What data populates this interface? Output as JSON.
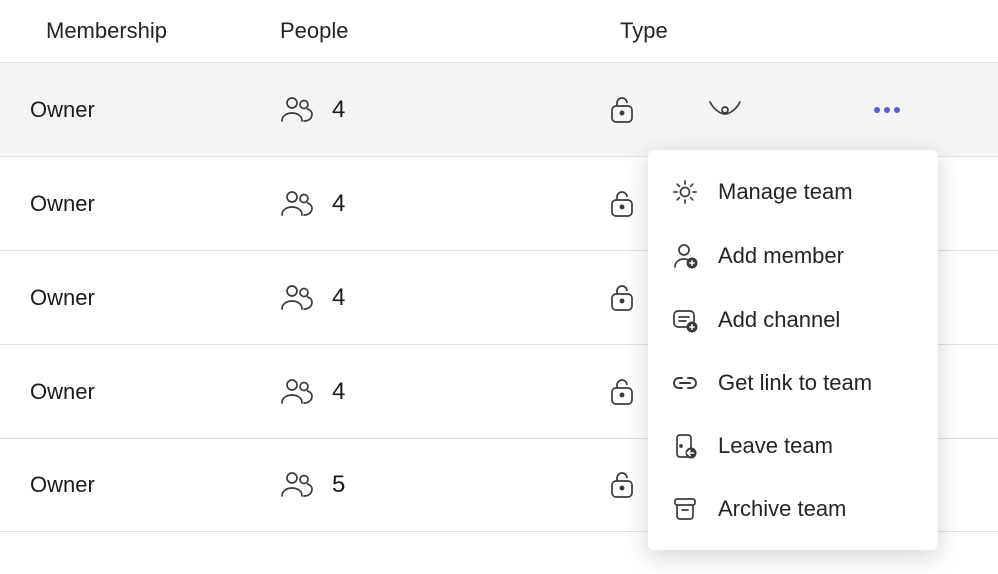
{
  "headers": {
    "membership": "Membership",
    "people": "People",
    "type": "Type"
  },
  "rows": [
    {
      "membership": "Owner",
      "people": "4",
      "active": true,
      "show_eye": true,
      "show_more": true
    },
    {
      "membership": "Owner",
      "people": "4",
      "active": false,
      "show_eye": false,
      "show_more": false
    },
    {
      "membership": "Owner",
      "people": "4",
      "active": false,
      "show_eye": false,
      "show_more": false
    },
    {
      "membership": "Owner",
      "people": "4",
      "active": false,
      "show_eye": false,
      "show_more": false
    },
    {
      "membership": "Owner",
      "people": "5",
      "active": false,
      "show_eye": false,
      "show_more": false
    }
  ],
  "menu": {
    "manage": "Manage team",
    "add_member": "Add member",
    "add_channel": "Add channel",
    "get_link": "Get link to team",
    "leave": "Leave team",
    "archive": "Archive team"
  }
}
